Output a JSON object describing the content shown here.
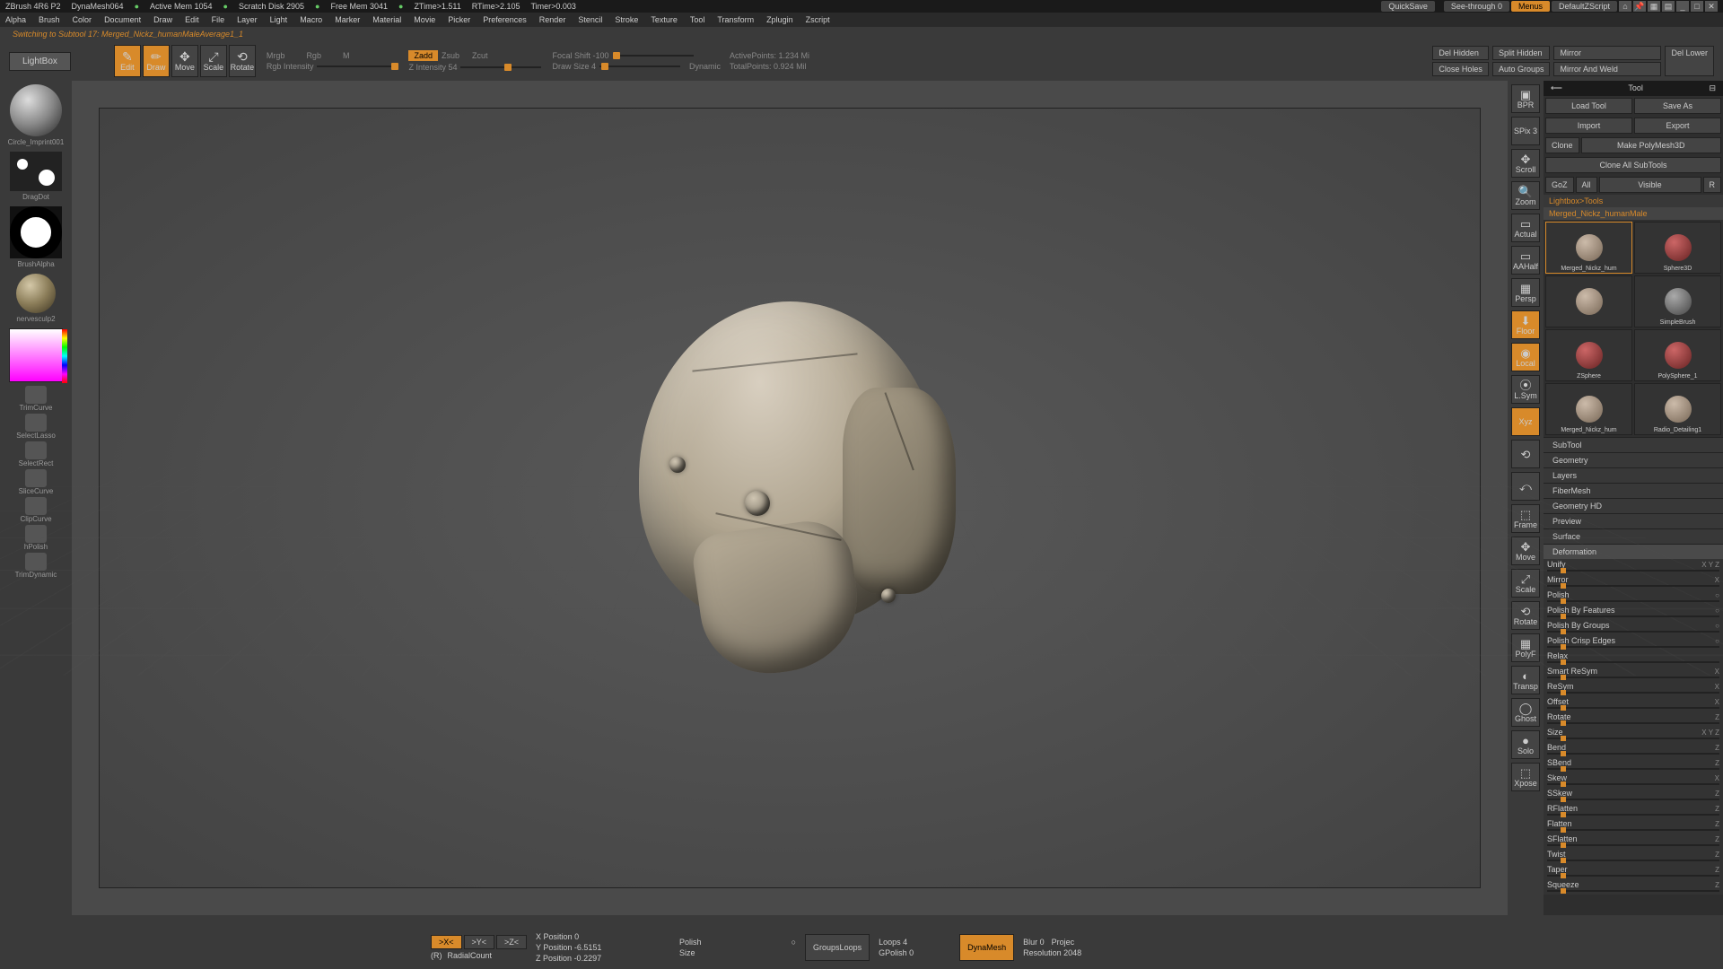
{
  "status": {
    "app": "ZBrush 4R6 P2",
    "doc": "DynaMesh064",
    "mem": "Active Mem 1054",
    "scratch": "Scratch Disk 2905",
    "free": "Free Mem 3041",
    "ztime": "ZTime>1.511",
    "rtime": "RTime>2.105",
    "timer": "Timer>0.003",
    "quicksave": "QuickSave",
    "seethrough": "See-through  0",
    "menus": "Menus",
    "script": "DefaultZScript"
  },
  "menu": [
    "Alpha",
    "Brush",
    "Color",
    "Document",
    "Draw",
    "Edit",
    "File",
    "Layer",
    "Light",
    "Macro",
    "Marker",
    "Material",
    "Movie",
    "Picker",
    "Preferences",
    "Render",
    "Stencil",
    "Stroke",
    "Texture",
    "Tool",
    "Transform",
    "Zplugin",
    "Zscript"
  ],
  "info_line": "Switching to Subtool 17:  Merged_Nickz_humanMaleAverage1_1",
  "toolbar": {
    "lightbox": "LightBox",
    "modes": [
      {
        "label": "Edit",
        "active": true,
        "ico": "✎"
      },
      {
        "label": "Draw",
        "active": true,
        "ico": "✏"
      },
      {
        "label": "Move",
        "active": false,
        "ico": "✥"
      },
      {
        "label": "Scale",
        "active": false,
        "ico": "⤢"
      },
      {
        "label": "Rotate",
        "active": false,
        "ico": "⟲"
      }
    ],
    "mrgb": "Mrgb",
    "rgb": "Rgb",
    "m": "M",
    "rgb_intensity": "Rgb Intensity",
    "zadd": "Zadd",
    "zsub": "Zsub",
    "zcut": "Zcut",
    "zintensity": "Z Intensity 54",
    "focal": "Focal Shift -100",
    "drawsize": "Draw Size 4",
    "dynamic": "Dynamic",
    "active_pts": "ActivePoints: 1.234 Mi",
    "total_pts": "TotalPoints: 0.924 Mil",
    "del_hidden": "Del Hidden",
    "close_holes": "Close Holes",
    "split_hidden": "Split Hidden",
    "auto_groups": "Auto Groups",
    "mirror": "Mirror",
    "mirror_weld": "Mirror And Weld",
    "del_lower": "Del Lower"
  },
  "left": {
    "mat1": "Circle_Imprint001",
    "stroke": "DragDot",
    "alpha": "BrushAlpha",
    "mat2": "nervesculp2",
    "brushes": [
      "TrimCurve",
      "SelectLasso",
      "SelectRect",
      "SliceCurve",
      "ClipCurve",
      "hPolish",
      "TrimDynamic"
    ]
  },
  "right_icons": [
    {
      "l": "BPR",
      "s": "▣"
    },
    {
      "l": "SPix 3",
      "s": ""
    },
    {
      "l": "Scroll",
      "s": "✥"
    },
    {
      "l": "Zoom",
      "s": "🔍"
    },
    {
      "l": "Actual",
      "s": "▭"
    },
    {
      "l": "AAHalf",
      "s": "▭"
    },
    {
      "l": "Persp",
      "s": "▦"
    },
    {
      "l": "Floor",
      "s": "⬇",
      "a": true
    },
    {
      "l": "Local",
      "s": "◉",
      "a": true
    },
    {
      "l": "L.Sym",
      "s": "⦿"
    },
    {
      "l": "Xyz",
      "s": "",
      "a": true
    },
    {
      "l": "",
      "s": "⟲"
    },
    {
      "l": "",
      "s": "⤺"
    },
    {
      "l": "Frame",
      "s": "⬚"
    },
    {
      "l": "Move",
      "s": "✥"
    },
    {
      "l": "Scale",
      "s": "⤢"
    },
    {
      "l": "Rotate",
      "s": "⟲"
    },
    {
      "l": "PolyF",
      "s": "▦"
    },
    {
      "l": "Transp",
      "s": "◐"
    },
    {
      "l": "Ghost",
      "s": "◯"
    },
    {
      "l": "Solo",
      "s": "●"
    },
    {
      "l": "Xpose",
      "s": "⬚"
    }
  ],
  "panel": {
    "title": "Tool",
    "row1": [
      "Load Tool",
      "Save As"
    ],
    "row2": [
      "Import",
      "Export"
    ],
    "row3": [
      "Clone",
      "Make PolyMesh3D"
    ],
    "row4": "Clone All SubTools",
    "row5": [
      "GoZ",
      "All",
      "Visible",
      "R"
    ],
    "lightbox": "Lightbox>Tools",
    "current": "Merged_Nickz_humanMale",
    "tools": [
      {
        "n": "Merged_Nickz_hum",
        "sel": true,
        "c": "tan"
      },
      {
        "n": "Sphere3D",
        "c": "red"
      },
      {
        "n": "",
        "c": "tan"
      },
      {
        "n": "SimpleBrush",
        "c": "grey"
      },
      {
        "n": "ZSphere",
        "c": "red"
      },
      {
        "n": "PolySphere_1",
        "c": "red"
      },
      {
        "n": "Merged_Nickz_hum",
        "c": "tan"
      },
      {
        "n": "Radio_Detailing1",
        "c": "tan"
      }
    ],
    "sections": [
      "SubTool",
      "Geometry",
      "Layers",
      "FiberMesh",
      "Geometry HD",
      "Preview",
      "Surface"
    ],
    "deformation": "Deformation",
    "defs": [
      {
        "l": "Unify",
        "a": "X Y Z"
      },
      {
        "l": "Mirror",
        "a": "X"
      },
      {
        "l": "Polish",
        "a": "○"
      },
      {
        "l": "Polish By Features",
        "a": "○"
      },
      {
        "l": "Polish By Groups",
        "a": "○"
      },
      {
        "l": "Polish Crisp Edges",
        "a": "○"
      },
      {
        "l": "Relax",
        "a": ""
      },
      {
        "l": "Smart ReSym",
        "a": "X"
      },
      {
        "l": "ReSym",
        "a": "X"
      },
      {
        "l": "Offset",
        "a": "X"
      },
      {
        "l": "Rotate",
        "a": "Z"
      },
      {
        "l": "Size",
        "a": "X Y Z"
      },
      {
        "l": "Bend",
        "a": "Z"
      },
      {
        "l": "SBend",
        "a": "Z"
      },
      {
        "l": "Skew",
        "a": "X"
      },
      {
        "l": "SSkew",
        "a": "Z"
      },
      {
        "l": "RFlatten",
        "a": "Z"
      },
      {
        "l": "Flatten",
        "a": "Z"
      },
      {
        "l": "SFlatten",
        "a": "Z"
      },
      {
        "l": "Twist",
        "a": "Z"
      },
      {
        "l": "Taper",
        "a": "Z"
      },
      {
        "l": "Squeeze",
        "a": "Z"
      }
    ]
  },
  "bottom": {
    "axes": [
      ">X<",
      ">Y<",
      ">Z<"
    ],
    "r": "(R)",
    "radial": "RadialCount",
    "xpos": "X Position 0",
    "ypos": "Y Position -6.5151",
    "zpos": "Z Position -0.2297",
    "polish": "Polish",
    "size": "Size",
    "groupsloops": "GroupsLoops",
    "loops": "Loops 4",
    "gpolish": "GPolish 0",
    "dynamesh": "DynaMesh",
    "blur": "Blur 0",
    "projec": "Projec",
    "resolution": "Resolution 2048"
  }
}
